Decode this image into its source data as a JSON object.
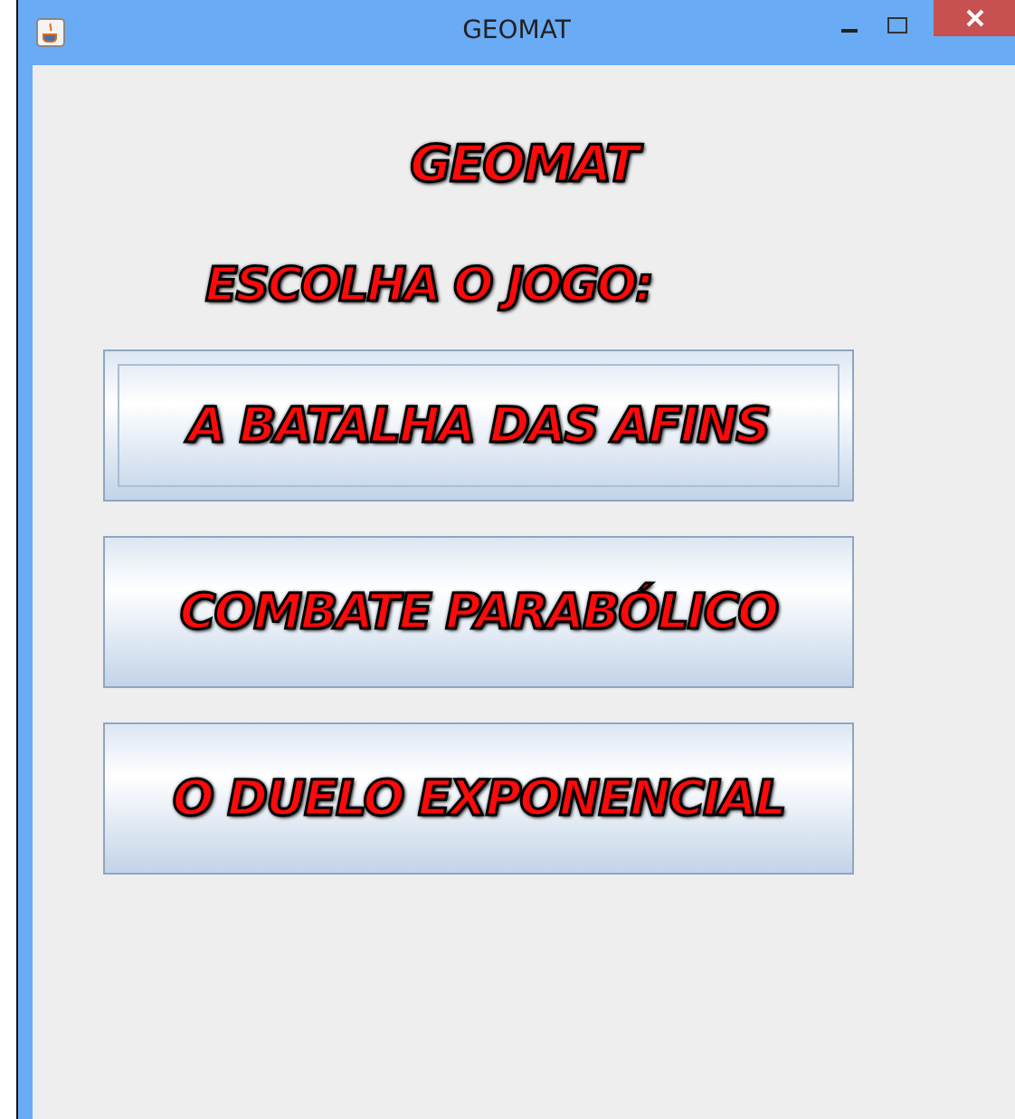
{
  "window": {
    "title": "GEOMAT"
  },
  "heading": "GEOMAT",
  "prompt": "ESCOLHA O JOGO:",
  "buttons": [
    {
      "label": "A BATALHA DAS AFINS",
      "focused": true
    },
    {
      "label": "COMBATE PARABÓLICO",
      "focused": false
    },
    {
      "label": "O DUELO EXPONENCIAL",
      "focused": false
    }
  ]
}
